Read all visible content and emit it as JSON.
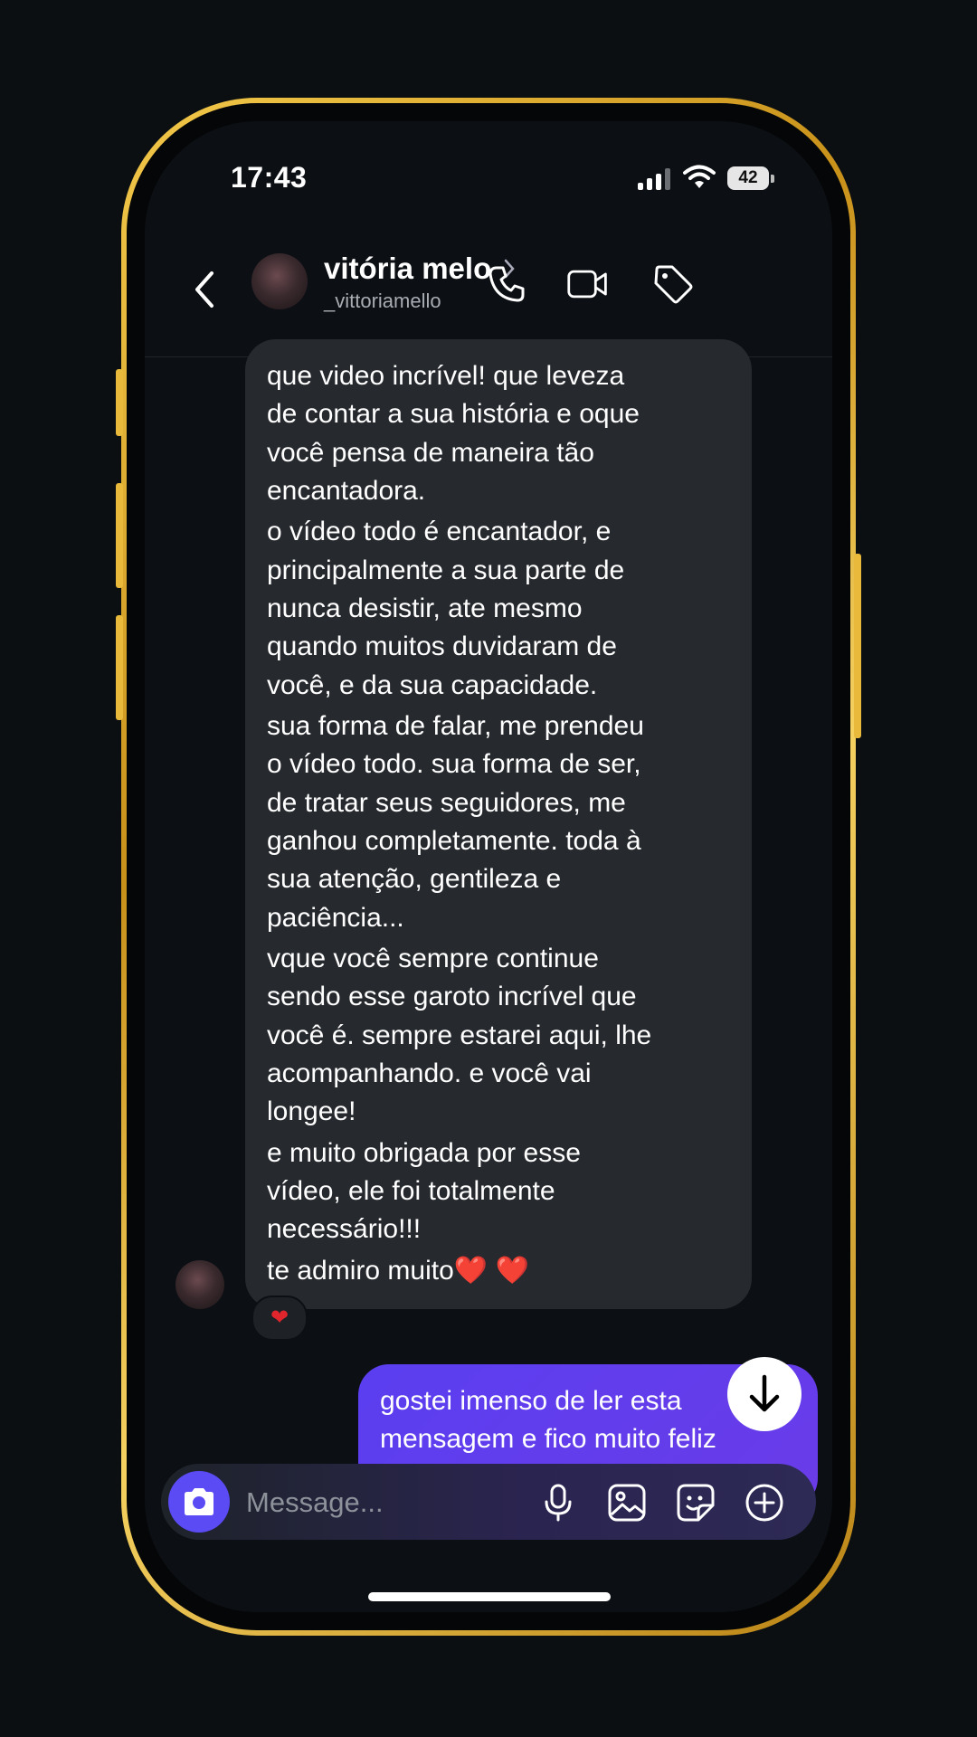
{
  "status_bar": {
    "time": "17:43",
    "battery": "42"
  },
  "header": {
    "contact_name": "vitória melo",
    "username": "_vittoriamello",
    "icons": [
      "back-icon",
      "chevron-right-icon",
      "phone-icon",
      "video-icon",
      "tag-icon"
    ]
  },
  "messages": {
    "incoming_lines": [
      "que video incrível! que leveza",
      "de contar a sua história e oque",
      "você pensa de maneira tão",
      "encantadora.",
      "o vídeo todo é encantador, e",
      "principalmente a sua parte de",
      "nunca desistir, ate mesmo",
      "quando muitos duvidaram de",
      "você, e da sua capacidade.",
      "sua forma de falar, me prendeu",
      "o vídeo todo. sua forma de ser,",
      "de tratar seus seguidores, me",
      "ganhou completamente. toda à",
      "sua atenção, gentileza e",
      "paciência...",
      "vque você sempre continue",
      "sendo esse garoto incrível que",
      "você é. sempre estarei aqui, lhe",
      "acompanhando. e você vai",
      "longee!",
      "e muito obrigada por esse",
      "vídeo, ele foi totalmente",
      "necessário!!!",
      "te admiro muito",
      "❤️ ❤️"
    ],
    "reaction": "❤",
    "outgoing_lines": [
      "gostei imenso de ler esta",
      "mensagem e fico muito feliz"
    ]
  },
  "composer": {
    "placeholder": "Message...",
    "icons": [
      "camera-icon",
      "microphone-icon",
      "gallery-icon",
      "sticker-icon",
      "add-icon"
    ]
  },
  "colors": {
    "background": "#0b0f12",
    "incoming_bubble": "#26292e",
    "outgoing_bubble": "#5a3ef0",
    "camera_button": "#5b4bf5",
    "reaction_heart": "#e0252d",
    "phone_frame": "#e8b93a"
  }
}
